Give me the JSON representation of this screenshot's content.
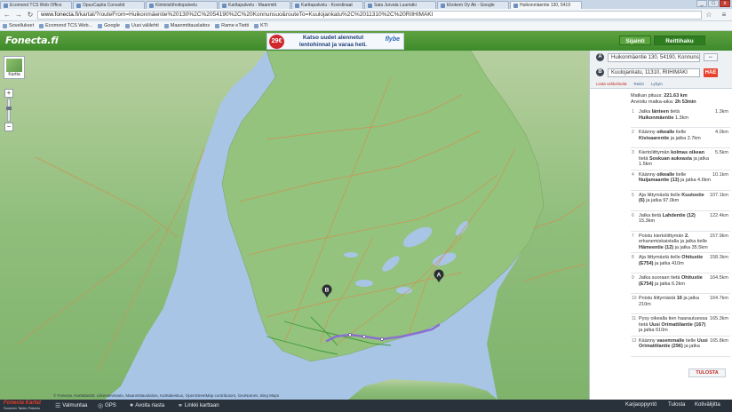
{
  "browser": {
    "tabs": [
      {
        "label": "Ecomond TCS Web Office"
      },
      {
        "label": "OpusCapita Consolid"
      },
      {
        "label": "Kiinteistöhoitopalvelu"
      },
      {
        "label": "Karttapalvelu - Maanmitt"
      },
      {
        "label": "Karttapalvelu - Koordinaat"
      },
      {
        "label": "Saia Jurvala Luumäki"
      },
      {
        "label": "Ekokem Oy Ab - Google"
      },
      {
        "label": "Huikonmäentie 130, 5419"
      }
    ],
    "url_host": "www.fonecta.fi",
    "url_path": "/kartat/?routeFrom=Huikonmäentie%20130%2C%2054190%2C%20Konnunsuo&routeTo=Kuulojankatu%2C%2011310%2C%20RIIHIMÄKI",
    "bookmarks": [
      "Sovellukset",
      "Ecomond TCS Web...",
      "Google",
      "Uusi välilehti",
      "Maanmittauslaitos",
      "Rame eTietti",
      "KTI"
    ],
    "controls": {
      "minimize": "_",
      "maximize": "□",
      "close": "x"
    }
  },
  "site": {
    "logo": "Fonecta.fi",
    "ad": {
      "price": "29€",
      "text": "Katso uudet alennetut lentohinnat ja varaa heti.",
      "brand": "flybe"
    },
    "sijainti_label": "Sijainti",
    "reittihaku_label": "Reittihaku"
  },
  "map": {
    "mini_label": "Kartta",
    "zoom_in": "+",
    "zoom_out": "−",
    "marker_a": "A",
    "marker_b": "B",
    "attribution": "© Fonecta. Karttatiedot: Liikennevirasto, Maanmittauslaitos, Karttakeskus, OpenStreetMap contributors, GeoNames, Bing Maps"
  },
  "route": {
    "from_pin": "A",
    "to_pin": "B",
    "from": "Huikonmäentie 130, 54190, Konnunsuo",
    "to": "Kuulojankatu, 11310, RIIHIMÄKI",
    "swap": "↔",
    "go": "HAE",
    "links": [
      "Lisää välikohteitä",
      "Reitin",
      "Lyhyin"
    ],
    "summary_distance_label": "Matkan pituus:",
    "summary_distance": "221.63 km",
    "summary_time_label": "Arvioitu matka-aika:",
    "summary_time": "2h 53min",
    "steps": [
      {
        "n": "1",
        "pre": "Jatka ",
        "bold1": "länteen",
        "mid": " tietä ",
        "bold2": "Huikonmäentie",
        "post": " 1.3km",
        "dist": "1.3km"
      },
      {
        "n": "2",
        "pre": "Käänny ",
        "bold1": "oikealle",
        "mid": " tielle ",
        "bold2": "Kivisaarentie",
        "post": " ja jatka 2.7km",
        "dist": "4.0km"
      },
      {
        "n": "3",
        "pre": "Kiertoliittymän ",
        "bold1": "kolmas oikean",
        "mid": " tietä ",
        "bold2": "Soskuan aukeasta",
        "post": " ja jatka 1.5km",
        "dist": "5.5km"
      },
      {
        "n": "4",
        "pre": "Käänny ",
        "bold1": "oikealle",
        "mid": " tielle ",
        "bold2": "Nuijamaantie (13)",
        "post": " ja jatka 4.6km",
        "dist": "10.1km"
      },
      {
        "n": "5",
        "pre": "Aja liittymästä tielle ",
        "bold1": "Kuutostie (6)",
        "mid": "",
        "bold2": "",
        "post": " ja jatka 97.0km",
        "dist": "107.1km"
      },
      {
        "n": "6",
        "pre": "Jatka tietä ",
        "bold1": "Lahdentie (12)",
        "mid": "",
        "bold2": "",
        "post": " 15.3km",
        "dist": "122.4km"
      },
      {
        "n": "7",
        "pre": "Poistu kiertoliittymän ",
        "bold1": "2.",
        "mid": " erkanemiskaistalla ja jatka tielle ",
        "bold2": "Hämeentie (12)",
        "post": " ja jatka 35.5km",
        "dist": "157.9km"
      },
      {
        "n": "8",
        "pre": "Aja liittymästä tielle ",
        "bold1": "Ohitustie (E754)",
        "mid": "",
        "bold2": "",
        "post": " ja jatka 410m",
        "dist": "158.3km"
      },
      {
        "n": "9",
        "pre": "Jatka suoraan tietä ",
        "bold1": "Ohitustie (E754)",
        "mid": "",
        "bold2": "",
        "post": " ja jatka 6.2km",
        "dist": "164.5km"
      },
      {
        "n": "10",
        "pre": "Poistu liittymästä ",
        "bold1": "16",
        "mid": "",
        "bold2": "",
        "post": " ja jatka 210m",
        "dist": "164.7km"
      },
      {
        "n": "11",
        "pre": "Pysy oikealla tien haarautuessa tietä ",
        "bold1": "Uusi Orimattilantie (167)",
        "mid": "",
        "bold2": "",
        "post": " ja jatka 610m",
        "dist": "165.3km"
      },
      {
        "n": "12",
        "pre": "Käänny ",
        "bold1": "vasemmalle",
        "mid": " tielle ",
        "bold2": "Uusi Orimattilantie (296)",
        "post": " ja jatka",
        "dist": "165.8km"
      }
    ],
    "print_label": "TULOSTA"
  },
  "footer": {
    "logo_name": "Fonecta Kartat",
    "logo_sub": "Suomen Tarkin Palvelu",
    "items_left": [
      {
        "label": "Valmuntaa",
        "icon": "menu-icon"
      },
      {
        "label": "GPS",
        "icon": "gps-icon"
      },
      {
        "label": "Avoita riasta",
        "icon": "location-icon"
      },
      {
        "label": "Linkki karttaan",
        "icon": "link-icon"
      }
    ],
    "items_right": [
      "Karjaoppyntö",
      "Tulosta",
      "Kotivälijitta"
    ]
  }
}
